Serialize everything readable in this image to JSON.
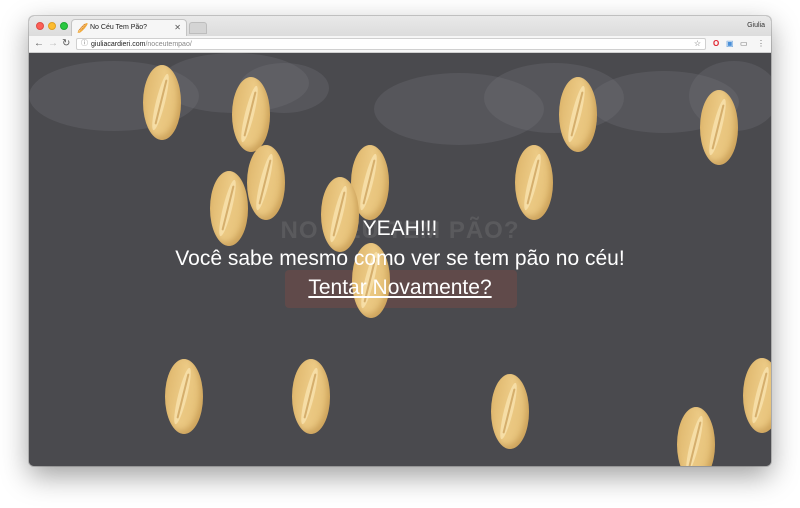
{
  "browser": {
    "tab_title": "No Céu Tem Pão?",
    "tab_icon": "bread-favicon",
    "profile_name": "Giulia",
    "url_host": "giuliacardieri.com",
    "url_path": "/noceutempao/"
  },
  "game": {
    "background_title": "NO CÉU TEM PÃO?",
    "result_heading": "YEAH!!!",
    "result_message": "Você sabe mesmo como ver se tem pão no céu!",
    "retry_link": "Tentar Novamente?",
    "bread_color": "#e6c27a",
    "background_color": "#4a4a4e"
  }
}
